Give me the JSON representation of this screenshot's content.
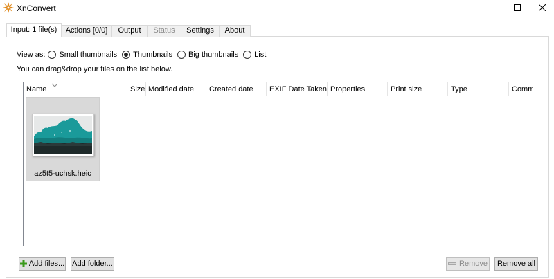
{
  "window": {
    "title": "XnConvert"
  },
  "tabs": [
    {
      "label": "Input: 1 file(s)",
      "state": "active"
    },
    {
      "label": "Actions [0/0]",
      "state": "normal"
    },
    {
      "label": "Output",
      "state": "normal"
    },
    {
      "label": "Status",
      "state": "disabled"
    },
    {
      "label": "Settings",
      "state": "normal"
    },
    {
      "label": "About",
      "state": "normal"
    }
  ],
  "view_as": {
    "label": "View as:",
    "options": [
      "Small thumbnails",
      "Thumbnails",
      "Big thumbnails",
      "List"
    ],
    "selected": "Thumbnails"
  },
  "hint": "You can drag&drop your files on the list below.",
  "file_list": {
    "columns": [
      "Name",
      "Size",
      "Modified date",
      "Created date",
      "EXIF Date Taken",
      "Properties",
      "Print size",
      "Type",
      "Comm"
    ],
    "files": [
      {
        "name": "az5t5-uchsk.heic"
      }
    ]
  },
  "buttons": {
    "add_files": "Add files...",
    "add_folder": "Add folder...",
    "remove": "Remove",
    "remove_all": "Remove all"
  },
  "colors": {
    "thumb_accent": "#1a9a9a",
    "add_icon": "#3a9a1a",
    "app_icon": "#e08a1e"
  }
}
